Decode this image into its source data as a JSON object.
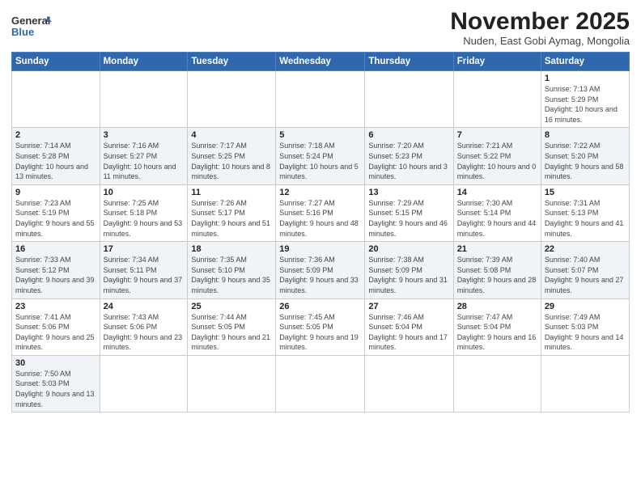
{
  "logo": {
    "line1": "General",
    "line2": "Blue"
  },
  "title": "November 2025",
  "subtitle": "Nuden, East Gobi Aymag, Mongolia",
  "weekdays": [
    "Sunday",
    "Monday",
    "Tuesday",
    "Wednesday",
    "Thursday",
    "Friday",
    "Saturday"
  ],
  "weeks": [
    [
      {
        "day": "",
        "info": ""
      },
      {
        "day": "",
        "info": ""
      },
      {
        "day": "",
        "info": ""
      },
      {
        "day": "",
        "info": ""
      },
      {
        "day": "",
        "info": ""
      },
      {
        "day": "",
        "info": ""
      },
      {
        "day": "1",
        "info": "Sunrise: 7:13 AM\nSunset: 5:29 PM\nDaylight: 10 hours and 16 minutes."
      }
    ],
    [
      {
        "day": "2",
        "info": "Sunrise: 7:14 AM\nSunset: 5:28 PM\nDaylight: 10 hours and 13 minutes."
      },
      {
        "day": "3",
        "info": "Sunrise: 7:16 AM\nSunset: 5:27 PM\nDaylight: 10 hours and 11 minutes."
      },
      {
        "day": "4",
        "info": "Sunrise: 7:17 AM\nSunset: 5:25 PM\nDaylight: 10 hours and 8 minutes."
      },
      {
        "day": "5",
        "info": "Sunrise: 7:18 AM\nSunset: 5:24 PM\nDaylight: 10 hours and 5 minutes."
      },
      {
        "day": "6",
        "info": "Sunrise: 7:20 AM\nSunset: 5:23 PM\nDaylight: 10 hours and 3 minutes."
      },
      {
        "day": "7",
        "info": "Sunrise: 7:21 AM\nSunset: 5:22 PM\nDaylight: 10 hours and 0 minutes."
      },
      {
        "day": "8",
        "info": "Sunrise: 7:22 AM\nSunset: 5:20 PM\nDaylight: 9 hours and 58 minutes."
      }
    ],
    [
      {
        "day": "9",
        "info": "Sunrise: 7:23 AM\nSunset: 5:19 PM\nDaylight: 9 hours and 55 minutes."
      },
      {
        "day": "10",
        "info": "Sunrise: 7:25 AM\nSunset: 5:18 PM\nDaylight: 9 hours and 53 minutes."
      },
      {
        "day": "11",
        "info": "Sunrise: 7:26 AM\nSunset: 5:17 PM\nDaylight: 9 hours and 51 minutes."
      },
      {
        "day": "12",
        "info": "Sunrise: 7:27 AM\nSunset: 5:16 PM\nDaylight: 9 hours and 48 minutes."
      },
      {
        "day": "13",
        "info": "Sunrise: 7:29 AM\nSunset: 5:15 PM\nDaylight: 9 hours and 46 minutes."
      },
      {
        "day": "14",
        "info": "Sunrise: 7:30 AM\nSunset: 5:14 PM\nDaylight: 9 hours and 44 minutes."
      },
      {
        "day": "15",
        "info": "Sunrise: 7:31 AM\nSunset: 5:13 PM\nDaylight: 9 hours and 41 minutes."
      }
    ],
    [
      {
        "day": "16",
        "info": "Sunrise: 7:33 AM\nSunset: 5:12 PM\nDaylight: 9 hours and 39 minutes."
      },
      {
        "day": "17",
        "info": "Sunrise: 7:34 AM\nSunset: 5:11 PM\nDaylight: 9 hours and 37 minutes."
      },
      {
        "day": "18",
        "info": "Sunrise: 7:35 AM\nSunset: 5:10 PM\nDaylight: 9 hours and 35 minutes."
      },
      {
        "day": "19",
        "info": "Sunrise: 7:36 AM\nSunset: 5:09 PM\nDaylight: 9 hours and 33 minutes."
      },
      {
        "day": "20",
        "info": "Sunrise: 7:38 AM\nSunset: 5:09 PM\nDaylight: 9 hours and 31 minutes."
      },
      {
        "day": "21",
        "info": "Sunrise: 7:39 AM\nSunset: 5:08 PM\nDaylight: 9 hours and 28 minutes."
      },
      {
        "day": "22",
        "info": "Sunrise: 7:40 AM\nSunset: 5:07 PM\nDaylight: 9 hours and 27 minutes."
      }
    ],
    [
      {
        "day": "23",
        "info": "Sunrise: 7:41 AM\nSunset: 5:06 PM\nDaylight: 9 hours and 25 minutes."
      },
      {
        "day": "24",
        "info": "Sunrise: 7:43 AM\nSunset: 5:06 PM\nDaylight: 9 hours and 23 minutes."
      },
      {
        "day": "25",
        "info": "Sunrise: 7:44 AM\nSunset: 5:05 PM\nDaylight: 9 hours and 21 minutes."
      },
      {
        "day": "26",
        "info": "Sunrise: 7:45 AM\nSunset: 5:05 PM\nDaylight: 9 hours and 19 minutes."
      },
      {
        "day": "27",
        "info": "Sunrise: 7:46 AM\nSunset: 5:04 PM\nDaylight: 9 hours and 17 minutes."
      },
      {
        "day": "28",
        "info": "Sunrise: 7:47 AM\nSunset: 5:04 PM\nDaylight: 9 hours and 16 minutes."
      },
      {
        "day": "29",
        "info": "Sunrise: 7:49 AM\nSunset: 5:03 PM\nDaylight: 9 hours and 14 minutes."
      }
    ],
    [
      {
        "day": "30",
        "info": "Sunrise: 7:50 AM\nSunset: 5:03 PM\nDaylight: 9 hours and 13 minutes."
      },
      {
        "day": "",
        "info": ""
      },
      {
        "day": "",
        "info": ""
      },
      {
        "day": "",
        "info": ""
      },
      {
        "day": "",
        "info": ""
      },
      {
        "day": "",
        "info": ""
      },
      {
        "day": "",
        "info": ""
      }
    ]
  ]
}
